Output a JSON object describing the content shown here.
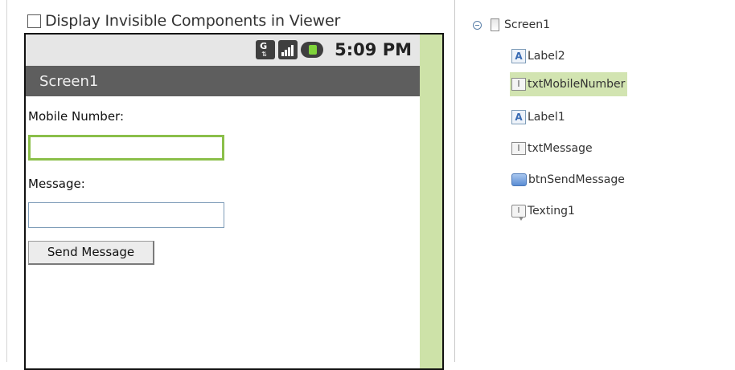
{
  "viewer": {
    "display_invisible_label": "Display Invisible Components in Viewer",
    "display_invisible_checked": false,
    "status_bar": {
      "time": "5:09 PM",
      "network_letter": "G",
      "icons": [
        "network-type-icon",
        "signal-strength-icon",
        "battery-charging-icon"
      ]
    },
    "screen_title": "Screen1",
    "form": {
      "mobile_label": "Mobile Number:",
      "mobile_value": "",
      "message_label": "Message:",
      "message_value": "",
      "send_button_label": "Send Message"
    },
    "colors": {
      "title_bar": "#5e5e5e",
      "status_bar": "#e6e6e6",
      "green_strip": "#cde2a8",
      "focus_border": "#8bbf4a"
    }
  },
  "components_tree": {
    "root": {
      "label": "Screen1",
      "expanded": true,
      "icon": "screen-icon"
    },
    "children": [
      {
        "label": "Label2",
        "icon": "label-icon",
        "icon_glyph": "A",
        "selected": false
      },
      {
        "label": "txtMobileNumber",
        "icon": "textbox-icon",
        "icon_glyph": "I",
        "selected": true
      },
      {
        "label": "Label1",
        "icon": "label-icon",
        "icon_glyph": "A",
        "selected": false
      },
      {
        "label": "txtMessage",
        "icon": "textbox-icon",
        "icon_glyph": "I",
        "selected": false
      },
      {
        "label": "btnSendMessage",
        "icon": "button-icon",
        "icon_glyph": "",
        "selected": false
      },
      {
        "label": "Texting1",
        "icon": "texting-icon",
        "icon_glyph": "I",
        "selected": false
      }
    ],
    "colors": {
      "selected_row": "#d2e4b1"
    }
  }
}
